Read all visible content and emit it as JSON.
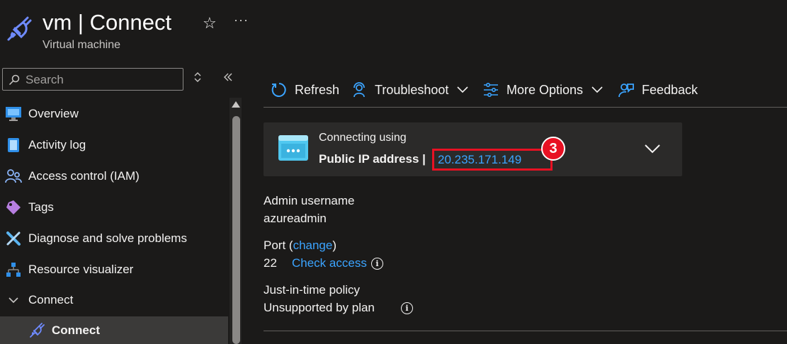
{
  "header": {
    "title": "vm | Connect",
    "subtitle": "Virtual machine",
    "favorite_icon": "star-icon",
    "more_icon": "ellipsis-icon"
  },
  "sidebar": {
    "search": {
      "placeholder": "Search"
    },
    "items": [
      {
        "label": "Overview",
        "icon": "monitor-icon"
      },
      {
        "label": "Activity log",
        "icon": "log-icon"
      },
      {
        "label": "Access control (IAM)",
        "icon": "people-icon"
      },
      {
        "label": "Tags",
        "icon": "tag-icon"
      },
      {
        "label": "Diagnose and solve problems",
        "icon": "wrench-icon"
      },
      {
        "label": "Resource visualizer",
        "icon": "hierarchy-icon"
      },
      {
        "label": "Connect",
        "icon": "chevron-down-icon",
        "expanded": true
      },
      {
        "label": "Connect",
        "icon": "plug-icon",
        "selected": true
      }
    ]
  },
  "toolbar": {
    "refresh": "Refresh",
    "troubleshoot": "Troubleshoot",
    "more_options": "More Options",
    "feedback": "Feedback"
  },
  "connect_card": {
    "line1": "Connecting using",
    "method": "Public IP address |",
    "ip": "20.235.171.149",
    "annotation_number": "3"
  },
  "details": {
    "admin_label": "Admin username",
    "admin_value": "azureadmin",
    "port_prefix": "Port (",
    "port_change": "change",
    "port_suffix": ")",
    "port_value": "22",
    "check_access": "Check access",
    "jit_label": "Just-in-time policy",
    "jit_value": "Unsupported by plan"
  },
  "colors": {
    "background": "#1b1a19",
    "accent": "#3ba4ff",
    "annotation_red": "#e81123"
  }
}
